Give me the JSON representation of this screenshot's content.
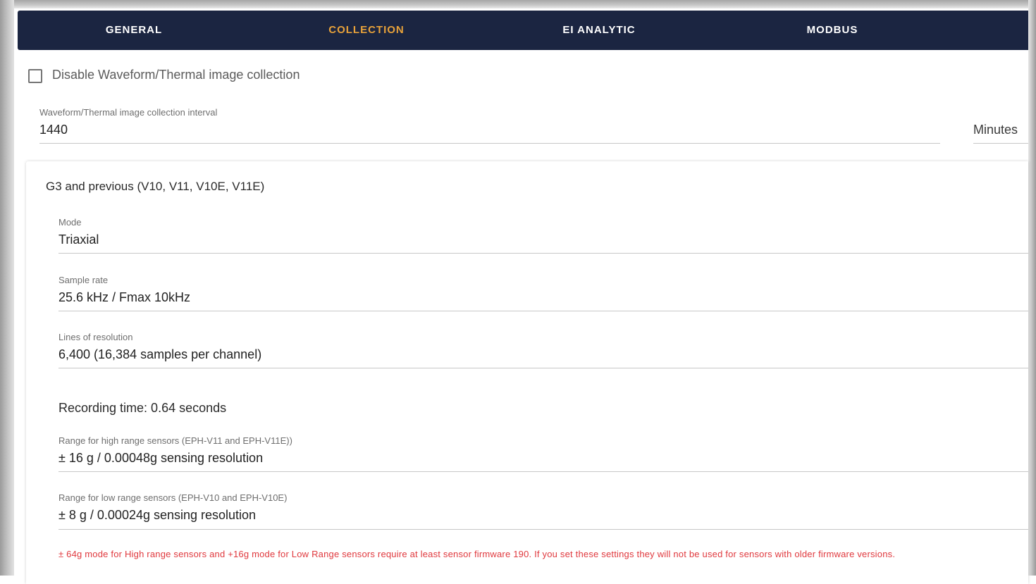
{
  "tabs": [
    {
      "label": "GENERAL",
      "active": false
    },
    {
      "label": "COLLECTION",
      "active": true
    },
    {
      "label": "EI ANALYTIC",
      "active": false
    },
    {
      "label": "MODBUS",
      "active": false
    }
  ],
  "colors": {
    "tabbar_bg": "#1b2541",
    "active_tab": "#e8a23a",
    "warning": "#e0393e"
  },
  "disable_collection": {
    "label": "Disable Waveform/Thermal image collection",
    "checked": false
  },
  "interval": {
    "label": "Waveform/Thermal image collection interval",
    "value": "1440",
    "unit": "Minutes"
  },
  "g3_section": {
    "title": "G3 and previous (V10, V11, V10E, V11E)",
    "mode": {
      "label": "Mode",
      "value": "Triaxial"
    },
    "sample_rate": {
      "label": "Sample rate",
      "value": "25.6 kHz / Fmax 10kHz"
    },
    "lines_of_resolution": {
      "label": "Lines of resolution",
      "value": "6,400 (16,384 samples per channel)"
    },
    "recording_time": "Recording time: 0.64 seconds",
    "high_range": {
      "label": "Range for high range sensors (EPH-V11 and EPH-V11E))",
      "value": "± 16 g / 0.00048g sensing resolution"
    },
    "low_range": {
      "label": "Range for low range sensors (EPH-V10 and EPH-V10E)",
      "value": "± 8 g / 0.00024g sensing resolution"
    },
    "warning": "± 64g mode for High range sensors and +16g mode for Low Range sensors require at least sensor firmware 190. If you set these settings they will not be used for sensors with older firmware versions."
  }
}
